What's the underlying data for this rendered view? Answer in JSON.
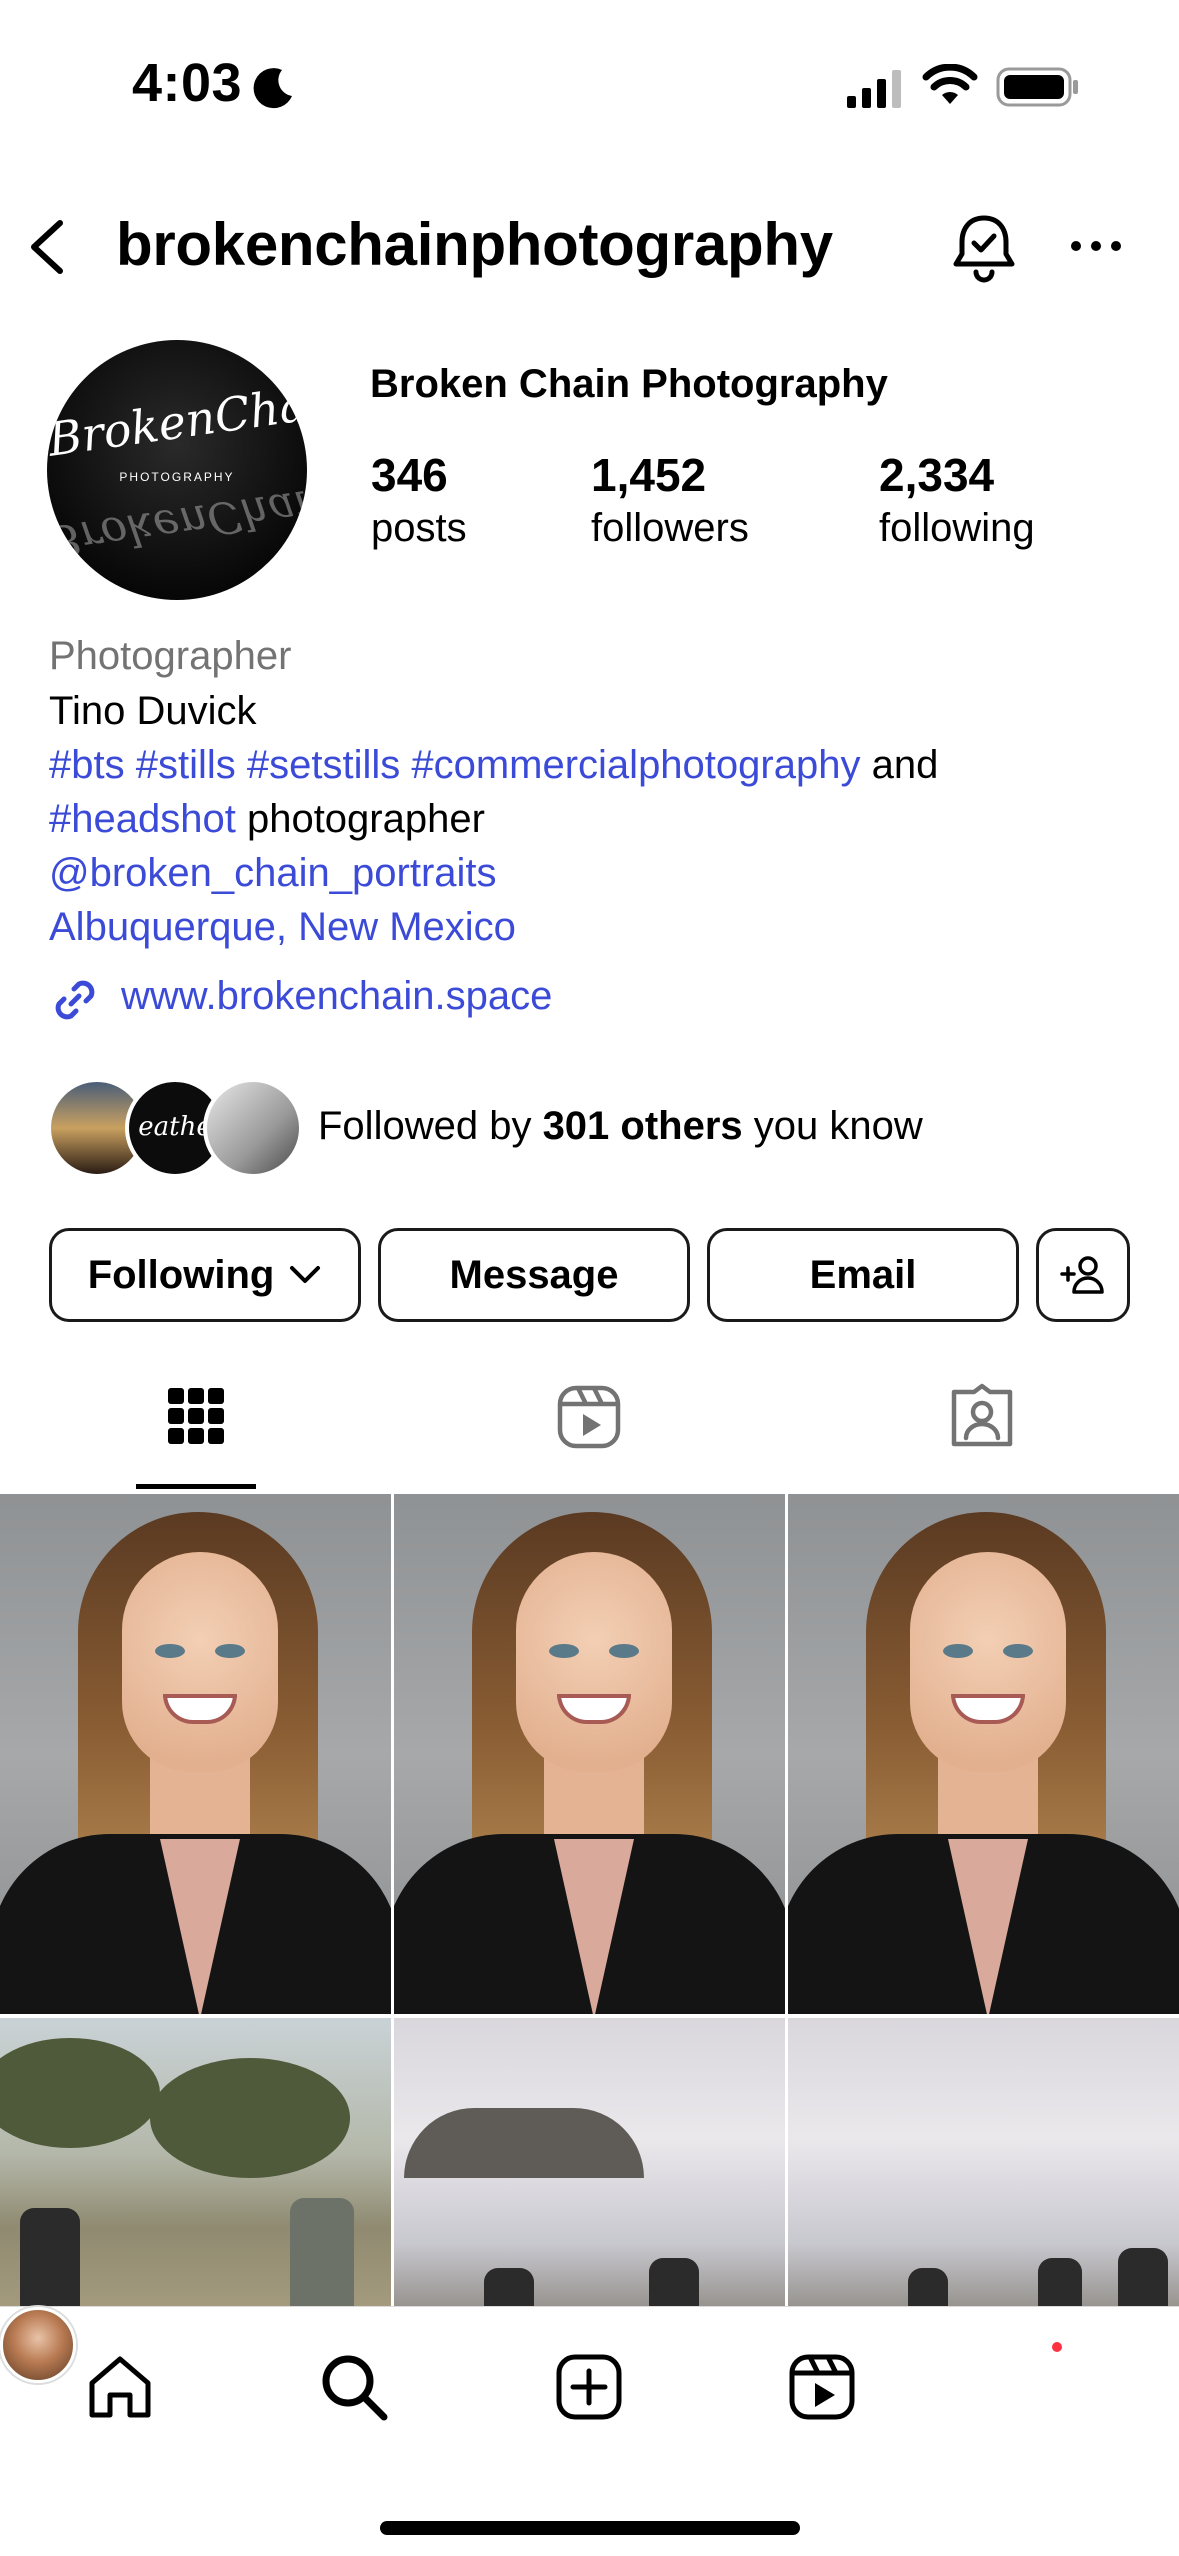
{
  "status_bar": {
    "time": "4:03"
  },
  "header": {
    "username": "brokenchainphotography"
  },
  "profile": {
    "avatar_text": "BrokenChain",
    "avatar_subtext": "PHOTOGRAPHY",
    "display_name": "Broken Chain Photography",
    "stats": {
      "posts": {
        "value": "346",
        "label": "posts"
      },
      "followers": {
        "value": "1,452",
        "label": "followers"
      },
      "following": {
        "value": "2,334",
        "label": "following"
      }
    }
  },
  "bio": {
    "category": "Photographer",
    "line1": "Tino Duvick",
    "tags_line": "#bts #stills #setstills #commercialphotography",
    "and_word": " and",
    "headshot_tag": "#headshot",
    "photographer_word": " photographer",
    "mention": "@broken_chain_portraits",
    "location": "Albuquerque, New Mexico",
    "link": "www.brokenchain.space"
  },
  "followed_by": {
    "prefix": "Followed by ",
    "count": "301 others",
    "suffix": " you know",
    "avatar2_text": "eathe"
  },
  "buttons": {
    "following": "Following",
    "message": "Message",
    "email": "Email"
  },
  "tabs": [
    "grid-icon",
    "reels-icon",
    "tagged-icon"
  ],
  "icons": {
    "back": "chevron-left-icon",
    "notifications": "bell-check-icon",
    "more": "more-horizontal-icon",
    "link": "link-icon",
    "add_user": "add-user-icon",
    "nav": [
      "home-icon",
      "search-icon",
      "create-icon",
      "reels-icon",
      "profile-avatar"
    ]
  },
  "colors": {
    "link": "#3b4bd8",
    "secondary_text": "#737373",
    "notification_dot": "#ff3040"
  }
}
